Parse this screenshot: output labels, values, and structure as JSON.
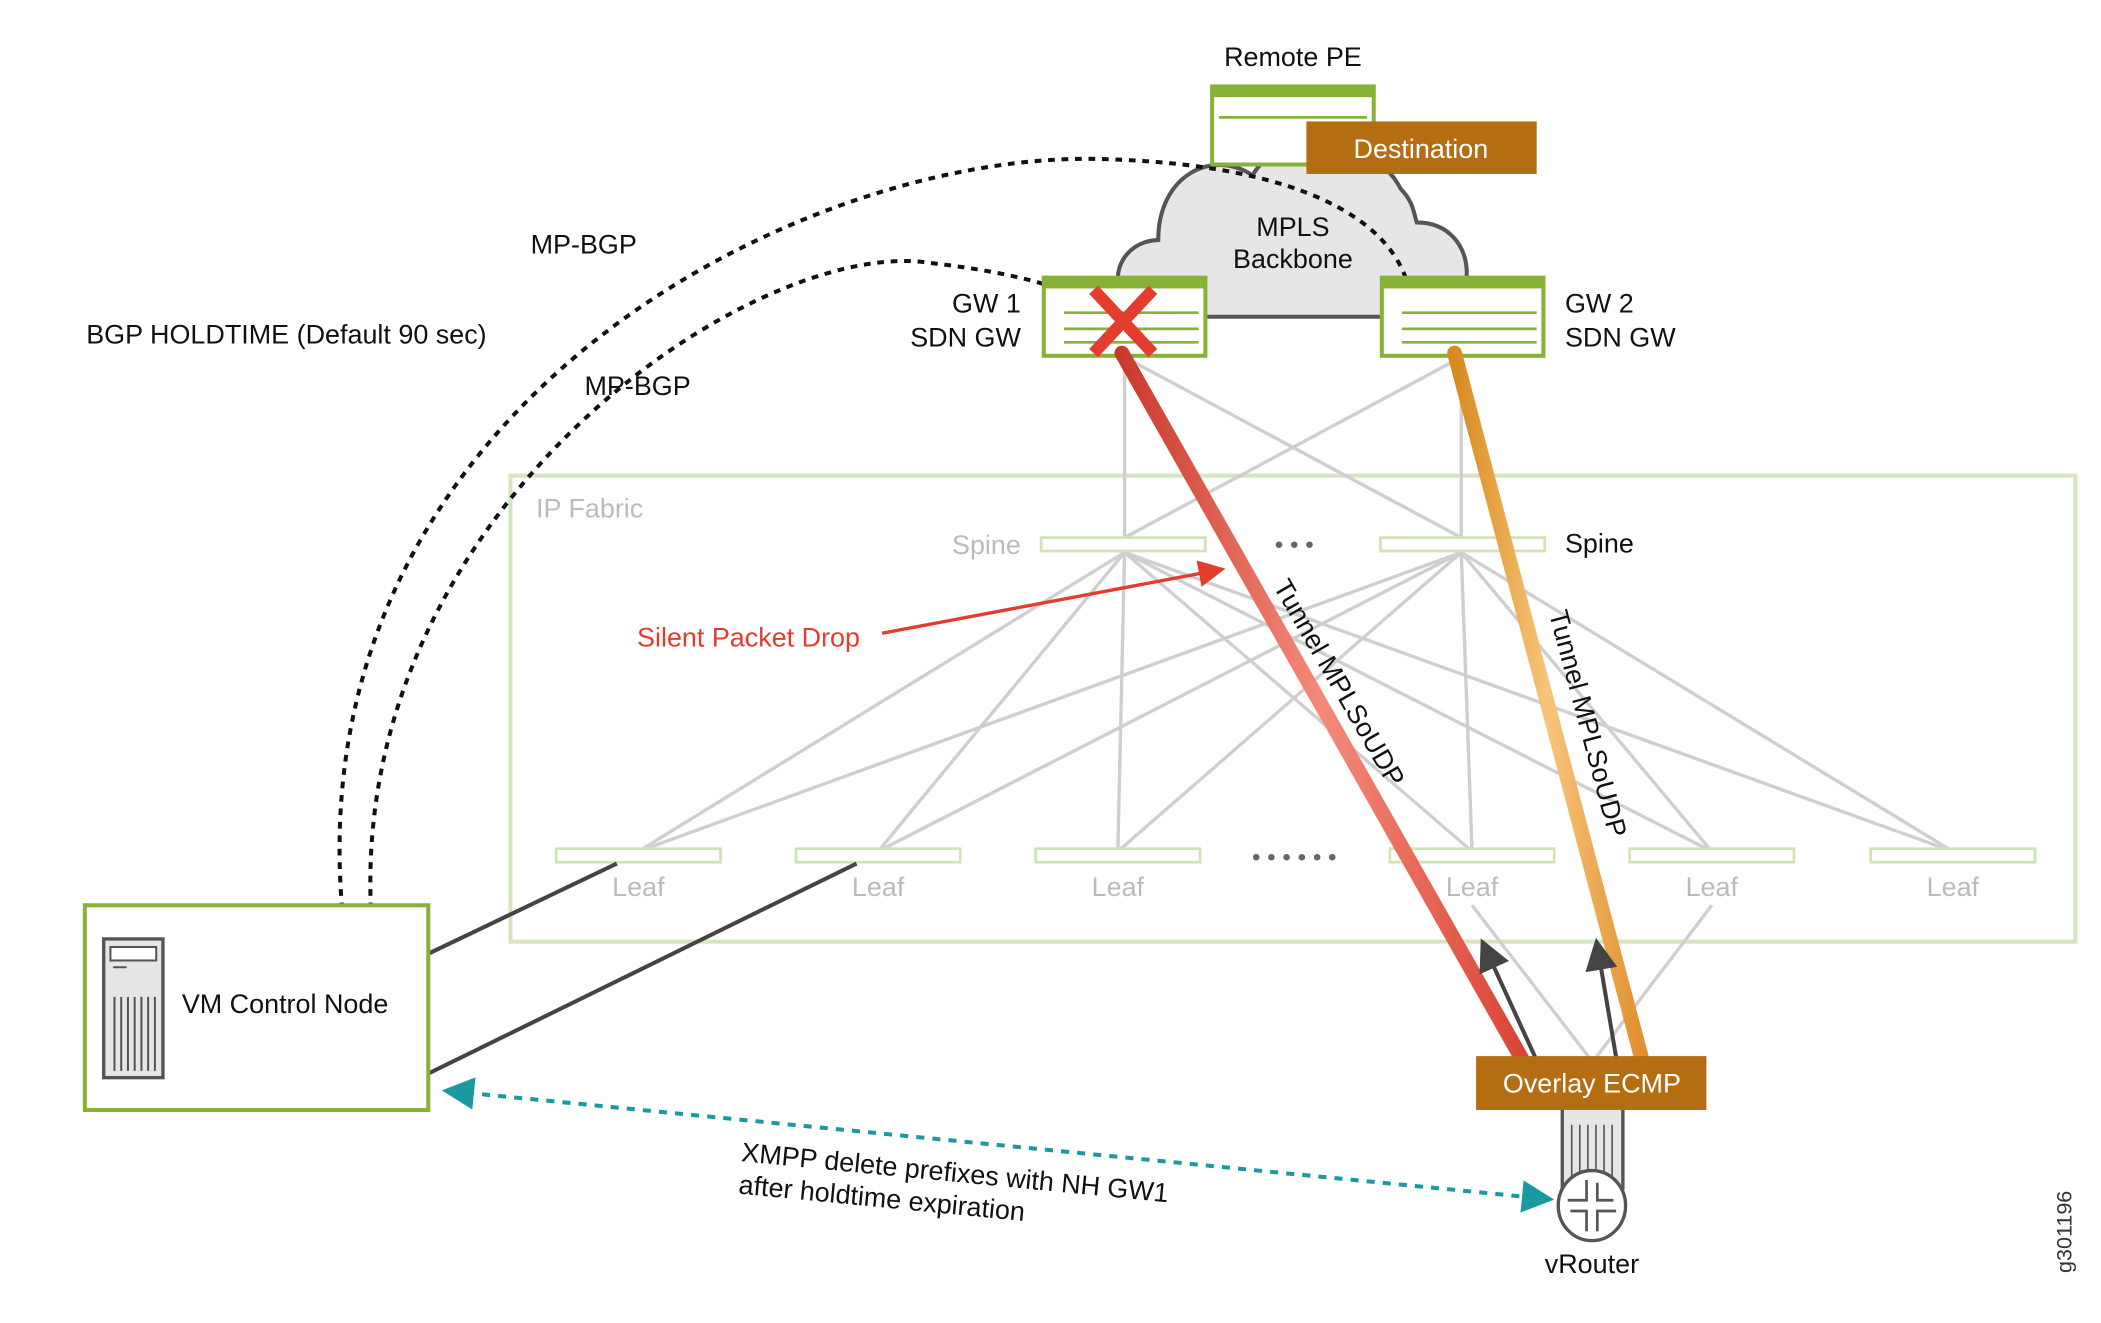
{
  "nodes": {
    "remote_pe": "Remote PE",
    "destination": "Destination",
    "mpls_line1": "MPLS",
    "mpls_line2": "Backbone",
    "gw1_line1": "GW 1",
    "gw1_line2": "SDN GW",
    "gw2_line1": "GW 2",
    "gw2_line2": "SDN GW",
    "ip_fabric": "IP Fabric",
    "spine_left": "Spine",
    "spine_right": "Spine",
    "spine_dots": "• • •",
    "leaf_dots": "• • • • • •",
    "leaves": [
      "Leaf",
      "Leaf",
      "Leaf",
      "Leaf",
      "Leaf",
      "Leaf"
    ],
    "vm_control_node": "VM Control Node",
    "overlay_ecmp": "Overlay ECMP",
    "vrouter": "vRouter"
  },
  "annotations": {
    "mpbgp_outer": "MP-BGP",
    "mpbgp_inner": "MP-BGP",
    "bgp_holdtime": "BGP HOLDTIME (Default 90 sec)",
    "silent_drop": "Silent Packet Drop",
    "tunnel_gw1": "Tunnel MPLSoUDP",
    "tunnel_gw2": "Tunnel MPLSoUDP",
    "xmpp_line1": "XMPP delete prefixes with NH GW1",
    "xmpp_line2": "after holdtime expiration",
    "figure_id": "g301196"
  },
  "colors": {
    "device_green": "#86b236",
    "label_orange": "#b56d12",
    "failure_red": "#e23d2e",
    "tunnel_red": "#e8503f",
    "tunnel_orange": "#f0a030",
    "xmpp_teal": "#1a9aa0",
    "fabric_border": "#d5e5c0"
  }
}
